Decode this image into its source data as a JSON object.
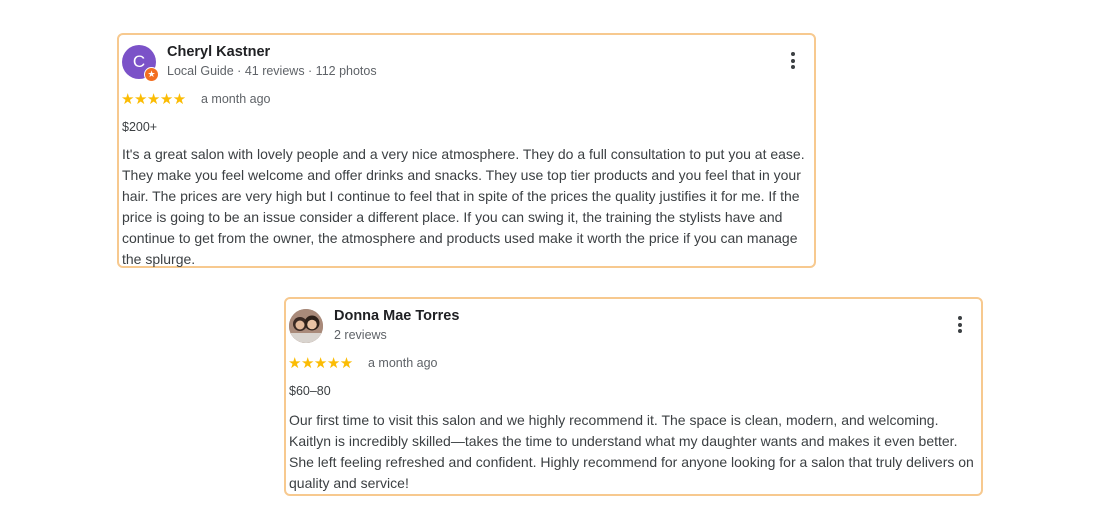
{
  "reviews": [
    {
      "reviewer": {
        "name": "Cheryl Kastner",
        "avatar_letter": "C",
        "meta": "Local Guide · 41 reviews · 112 photos",
        "avatar_color": "#7b52c8"
      },
      "rating_stars": "★★★★★",
      "rating": 5,
      "when": "a month ago",
      "price": "$200+",
      "text": "It's a great salon with lovely people and a very nice atmosphere. They do a full consultation to put you at ease. They make you feel welcome and offer drinks and snacks. They use top tier products and you feel that in your hair. The prices are very high but I continue to feel that in spite of the prices the quality justifies it for me. If the price is going to be an issue consider a different place. If you can swing it, the training the stylists have and continue to get from the owner, the atmosphere and products used make it worth the price if you can manage the splurge.",
      "menu_icon": "more-vert-icon"
    },
    {
      "reviewer": {
        "name": "Donna Mae Torres",
        "meta": "2 reviews"
      },
      "rating_stars": "★★★★★",
      "rating": 5,
      "when": "a month ago",
      "price": "$60–80",
      "text": "Our first time to visit this salon and we highly recommend it. The space is clean, modern, and welcoming. Kaitlyn is incredibly skilled—takes the time to understand what my daughter wants and makes it even better. She left feeling refreshed and confident. Highly recommend for anyone looking for a salon that truly delivers on quality and service!",
      "menu_icon": "more-vert-icon"
    }
  ],
  "colors": {
    "card_border": "#f7c98f",
    "star": "#fbbc04",
    "secondary_text": "#5f6368"
  }
}
